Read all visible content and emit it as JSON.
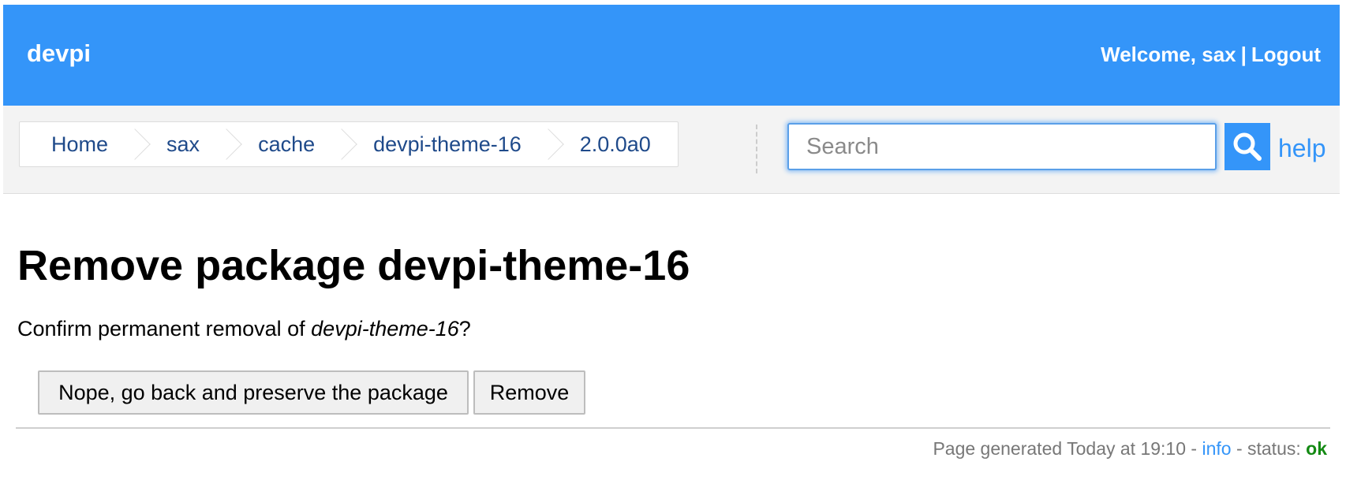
{
  "header": {
    "brand": "devpi",
    "welcome": "Welcome, sax",
    "separator": "|",
    "logout": "Logout",
    "bg_color": "#3495f9"
  },
  "breadcrumbs": [
    {
      "label": "Home"
    },
    {
      "label": "sax"
    },
    {
      "label": "cache"
    },
    {
      "label": "devpi-theme-16"
    },
    {
      "label": "2.0.0a0"
    }
  ],
  "search": {
    "placeholder": "Search",
    "value": "",
    "button_icon": "search-icon"
  },
  "help_link": "help",
  "main": {
    "title": "Remove package devpi-theme-16",
    "confirm_prefix": "Confirm permanent removal of ",
    "confirm_package": "devpi-theme-16",
    "confirm_suffix": "?",
    "nope_button": "Nope, go back and preserve the package",
    "remove_button": "Remove"
  },
  "footer": {
    "generated": "Page generated Today at 19:10 - ",
    "info": "info",
    "status_prefix": " - status: ",
    "status": "ok",
    "status_color": "#148a14"
  }
}
